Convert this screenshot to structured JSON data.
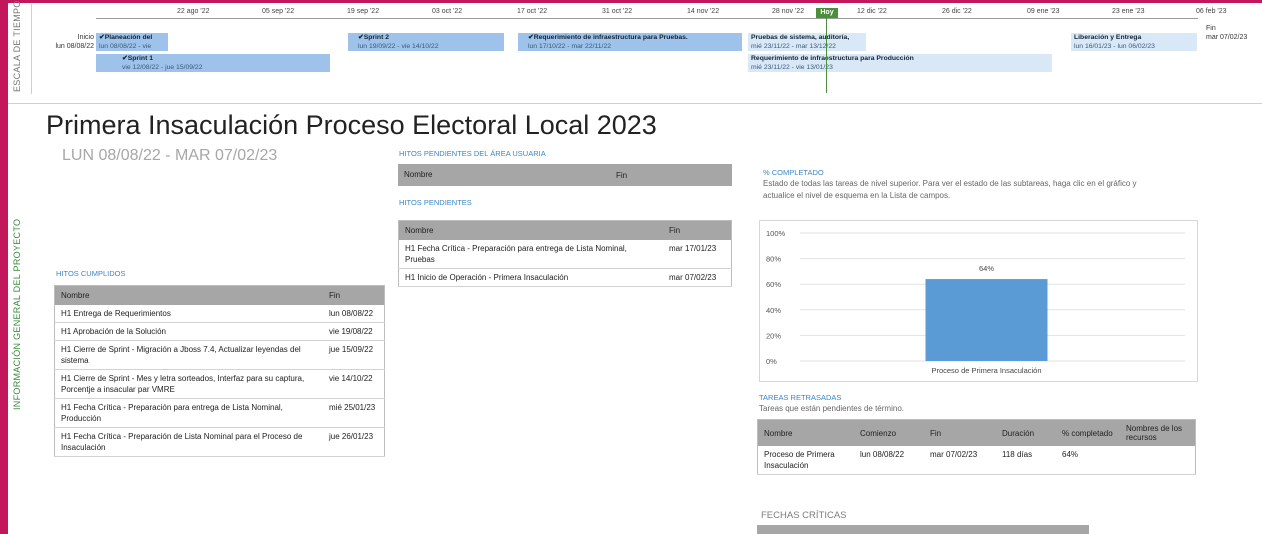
{
  "side_labels": {
    "timeline": "ESCALA DE TIEMPO",
    "project": "INFORMACIÓN GENERAL DEL PROYECTO"
  },
  "timeline": {
    "start_label": "Inicio",
    "start_date": "lun 08/08/22",
    "end_label": "Fin",
    "end_date": "mar 07/02/23",
    "today_label": "Hoy",
    "ticks": [
      "22 ago '22",
      "05 sep '22",
      "19 sep '22",
      "03 oct '22",
      "17 oct '22",
      "31 oct '22",
      "14 nov '22",
      "28 nov '22",
      "12 dic '22",
      "26 dic '22",
      "09 ene '23",
      "23 ene '23",
      "06 feb '23"
    ],
    "tasks": [
      {
        "name": "✔Planeación del",
        "dates": "lun 08/08/22 - vie"
      },
      {
        "name": "✔Sprint 1",
        "dates": "vie 12/08/22 - jue 15/09/22"
      },
      {
        "name": "✔Sprint 2",
        "dates": "lun 19/09/22 - vie 14/10/22"
      },
      {
        "name": "✔Requerimiento de infraestructura para Pruebas.",
        "dates": "lun 17/10/22 - mar 22/11/22"
      },
      {
        "name": "Pruebas de sistema, auditoría,",
        "dates": "mié 23/11/22 - mar 13/12/22"
      },
      {
        "name": "Requerimiento de infraestructura para Producción",
        "dates": "mié 23/11/22 - vie 13/01/23"
      },
      {
        "name": "Liberación y Entrega",
        "dates": "lun 16/01/23 - lun 06/02/23"
      }
    ]
  },
  "report": {
    "title": "Primera Insaculación Proceso Electoral Local 2023",
    "date_range": "LUN 08/08/22 - MAR 07/02/23"
  },
  "hitos_cumplidos": {
    "label": "HITOS CUMPLIDOS",
    "headers": [
      "Nombre",
      "Fin"
    ],
    "rows": [
      [
        "H1 Entrega de Requerimientos",
        "lun 08/08/22"
      ],
      [
        "H1 Aprobación de la Solución",
        "vie 19/08/22"
      ],
      [
        "H1 Cierre de Sprint - Migración a Jboss 7.4, Actualizar leyendas del sistema",
        "jue 15/09/22"
      ],
      [
        "H1 Cierre de Sprint - Mes y letra sorteados, Interfaz para su captura, Porcentje a insacular par VMRE",
        "vie 14/10/22"
      ],
      [
        "H1 Fecha Crítica - Preparación para entrega de Lista Nominal, Producción",
        "mié 25/01/23"
      ],
      [
        "H1 Fecha Crítica - Preparación de Lista Nominal para el Proceso de Insaculación",
        "jue 26/01/23"
      ]
    ]
  },
  "hitos_usuaria": {
    "label": "HITOS PENDIENTES DEL ÁREA USUARIA",
    "headers": [
      "Nombre",
      "Fin"
    ]
  },
  "hitos_pendientes": {
    "label": "HITOS PENDIENTES",
    "headers": [
      "Nombre",
      "Fin"
    ],
    "rows": [
      [
        "H1 Fecha Crítica - Preparación para entrega de Lista Nominal, Pruebas",
        "mar 17/01/23"
      ],
      [
        "H1 Inicio de Operación - Primera Insaculación",
        "mar 07/02/23"
      ]
    ]
  },
  "completado": {
    "label": "% COMPLETADO",
    "description": "Estado de todas las tareas de nivel superior. Para ver el estado de las subtareas, haga clic en el gráfico y actualice el nivel de esquema en la Lista de campos."
  },
  "chart_data": {
    "type": "bar",
    "categories": [
      "Proceso de Primera Insaculación"
    ],
    "values": [
      64
    ],
    "value_labels": [
      "64%"
    ],
    "yticks": [
      "100%",
      "80%",
      "60%",
      "40%",
      "20%",
      "0%"
    ],
    "ylim": [
      0,
      100
    ],
    "color": "#5b9bd5"
  },
  "retrasadas": {
    "label": "TAREAS RETRASADAS",
    "description": "Tareas que están pendientes de término.",
    "headers": [
      "Nombre",
      "Comienzo",
      "Fin",
      "Duración",
      "% completado",
      "Nombres de los recursos"
    ],
    "rows": [
      [
        "Proceso de Primera Insaculación",
        "lun 08/08/22",
        "mar 07/02/23",
        "118 días",
        "64%",
        ""
      ]
    ]
  },
  "fechas_criticas": {
    "label": "FECHAS CRÍTICAS"
  }
}
